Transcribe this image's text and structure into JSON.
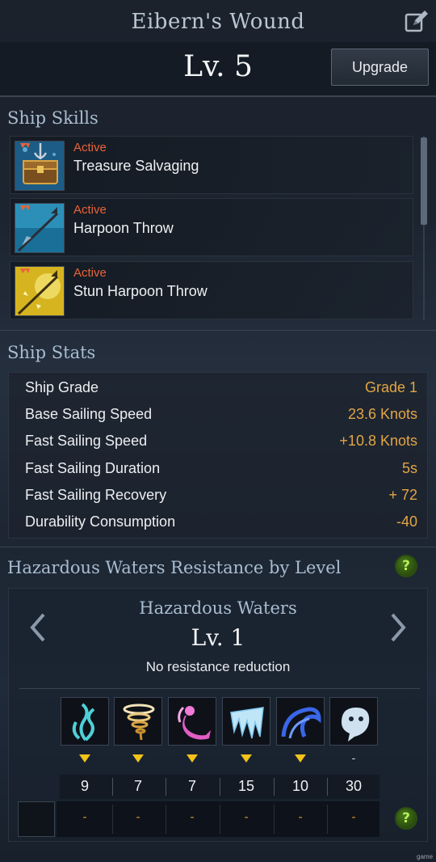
{
  "header": {
    "title": "Eibern's Wound",
    "level": "Lv. 5",
    "upgrade_label": "Upgrade",
    "edit_icon": "edit-icon"
  },
  "skills_section": {
    "title": "Ship Skills",
    "items": [
      {
        "type": "Active",
        "name": "Treasure Salvaging",
        "icon": "treasure-chest-icon"
      },
      {
        "type": "Active",
        "name": "Harpoon Throw",
        "icon": "harpoon-icon"
      },
      {
        "type": "Active",
        "name": "Stun Harpoon Throw",
        "icon": "stun-harpoon-icon"
      }
    ]
  },
  "stats_section": {
    "title": "Ship Stats",
    "rows": [
      {
        "label": "Ship Grade",
        "value": "Grade 1"
      },
      {
        "label": "Base Sailing Speed",
        "value": "23.6 Knots"
      },
      {
        "label": "Fast Sailing Speed",
        "value": "+10.8 Knots"
      },
      {
        "label": "Fast Sailing Duration",
        "value": "5s"
      },
      {
        "label": "Fast Sailing Recovery",
        "value": "+ 72"
      },
      {
        "label": "Durability Consumption",
        "value": "-40"
      }
    ]
  },
  "hazard_section": {
    "title": "Hazardous Waters Resistance by Level",
    "help": "?",
    "subtitle": "Hazardous Waters",
    "level": "Lv. 1",
    "description": "No resistance reduction",
    "types": [
      {
        "icon": "kelp-icon",
        "marker": "triangle",
        "value": "9",
        "resist": "-"
      },
      {
        "icon": "whirlwind-icon",
        "marker": "triangle",
        "value": "7",
        "resist": "-"
      },
      {
        "icon": "mermaid-icon",
        "marker": "triangle",
        "value": "7",
        "resist": "-"
      },
      {
        "icon": "ice-icon",
        "marker": "triangle",
        "value": "15",
        "resist": "-"
      },
      {
        "icon": "wave-icon",
        "marker": "triangle",
        "value": "10",
        "resist": "-"
      },
      {
        "icon": "ghost-icon",
        "marker": "-",
        "value": "30",
        "resist": "-"
      }
    ],
    "bottom_help": "?"
  },
  "colors": {
    "accent_orange": "#e3a544",
    "active_red": "#e8643a",
    "marker_yellow": "#f3c21b",
    "section_title": "#a9bdd0"
  },
  "watermark": "game"
}
